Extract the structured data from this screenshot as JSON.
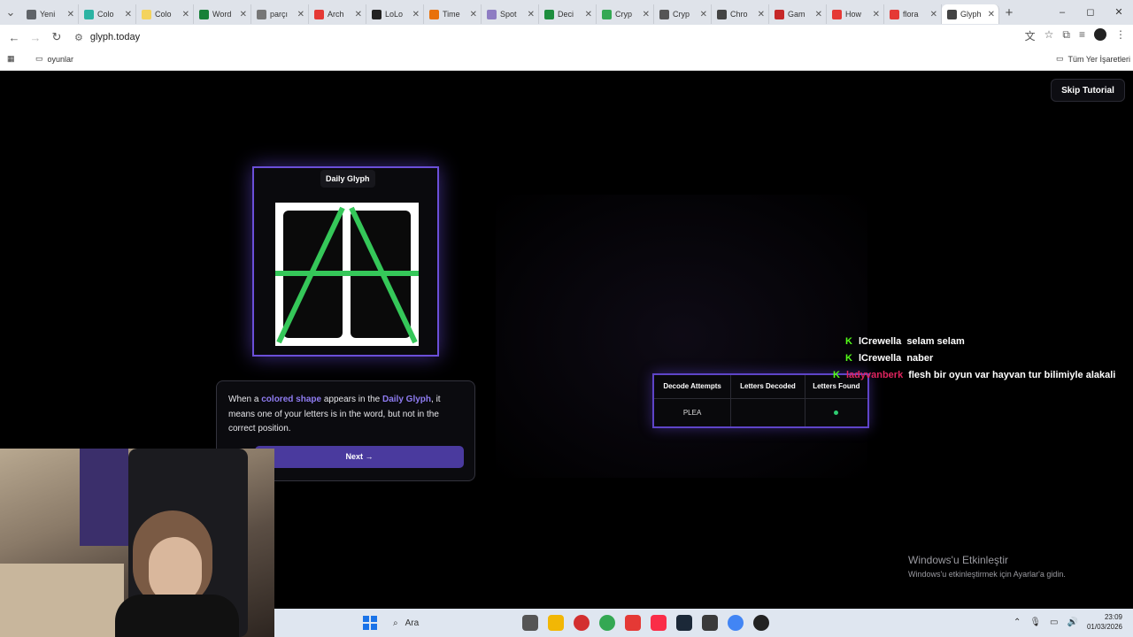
{
  "browser": {
    "tabs": [
      {
        "label": "Yeni",
        "color": "#5f6368"
      },
      {
        "label": "Colo",
        "color": "#2bb3a3"
      },
      {
        "label": "Colo",
        "color": "#f4d35e"
      },
      {
        "label": "Word",
        "color": "#188038"
      },
      {
        "label": "parçı",
        "color": "#777"
      },
      {
        "label": "Arch",
        "color": "#e53935"
      },
      {
        "label": "LoLo",
        "color": "#222"
      },
      {
        "label": "Time",
        "color": "#e8710a"
      },
      {
        "label": "Spot",
        "color": "#8e7cc3"
      },
      {
        "label": "Deci",
        "color": "#1e8e3e"
      },
      {
        "label": "Cryp",
        "color": "#34a853"
      },
      {
        "label": "Cryp",
        "color": "#555"
      },
      {
        "label": "Chro",
        "color": "#444"
      },
      {
        "label": "Gam",
        "color": "#c62828"
      },
      {
        "label": "How",
        "color": "#e53935"
      },
      {
        "label": "flora",
        "color": "#e53935"
      },
      {
        "label": "Glyph",
        "color": "#444",
        "active": true
      }
    ],
    "new_tab": "+",
    "window_controls": [
      "–",
      "◻",
      "✕"
    ],
    "address": "glyph.today",
    "bookmarks_left": "oyunlar",
    "bookmarks_right": "Tüm Yer İşaretleri"
  },
  "page": {
    "skip_button": "Skip Tutorial",
    "glyph_card": {
      "title": "Daily Glyph",
      "border_color": "#6b4fd8",
      "glyph_color": "#35c759"
    },
    "tooltip": {
      "text_1": "When a ",
      "highlight_1": "colored shape",
      "text_2": " appears in the ",
      "highlight_2": "Daily Glyph",
      "text_3": ", it means one of your letters is in the word, but not in the correct position.",
      "next_button": "Next →"
    },
    "stats": {
      "headers": [
        "Decode Attempts",
        "Letters Decoded",
        "Letters Found"
      ],
      "row": [
        "PLEA",
        "",
        "•"
      ]
    }
  },
  "chat": [
    {
      "user": "lCrewella",
      "message": "selam selam",
      "user_color": "#ffffff"
    },
    {
      "user": "lCrewella",
      "message": "naber",
      "user_color": "#ffffff"
    },
    {
      "user": "ladyvanberk",
      "message": "flesh bir oyun var hayvan tur bilimiyle alakali",
      "user_color": "#e0245e"
    }
  ],
  "windows_activation": {
    "title": "Windows'u Etkinleştir",
    "subtitle": "Windows'u etkinleştirmek için Ayarlar'a gidin."
  },
  "taskbar": {
    "search_placeholder": "Ara",
    "time": "23:09",
    "date": "01/03/2026"
  }
}
